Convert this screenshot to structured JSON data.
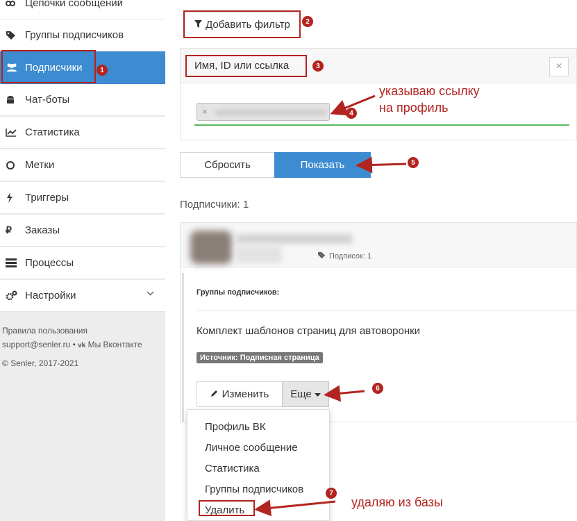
{
  "sidebar": {
    "items": [
      {
        "label": "Цепочки сообщений",
        "icon": "chain-icon"
      },
      {
        "label": "Группы подписчиков",
        "icon": "tag-icon"
      },
      {
        "label": "Подписчики",
        "icon": "users-icon"
      },
      {
        "label": "Чат-боты",
        "icon": "android-icon"
      },
      {
        "label": "Статистика",
        "icon": "chart-icon"
      },
      {
        "label": "Метки",
        "icon": "circle-icon"
      },
      {
        "label": "Триггеры",
        "icon": "bolt-icon"
      },
      {
        "label": "Заказы",
        "icon": "ruble-icon"
      },
      {
        "label": "Процессы",
        "icon": "list-icon"
      },
      {
        "label": "Настройки",
        "icon": "gears-icon"
      }
    ],
    "footer": {
      "terms": "Правила пользования",
      "support": "support@senler.ru",
      "vk": "Мы Вконтакте",
      "copyright": "© Senler, 2017-2021"
    }
  },
  "filter": {
    "add_filter_label": "Добавить фильтр",
    "field_label": "Имя, ID или ссылка",
    "close_label": "×",
    "tag_remove": "×"
  },
  "actions": {
    "reset_label": "Сбросить",
    "show_label": "Показать"
  },
  "results": {
    "count_text": "Подписчики: 1"
  },
  "subscriber": {
    "subscriptions_text": "Подписок: 1",
    "groups_heading": "Группы подписчиков:",
    "group_name": "Комплект шаблонов страниц для автоворонки",
    "source_badge": "Источник: Подписная страница",
    "edit_label": "Изменить",
    "more_label": "Еще"
  },
  "dropdown": {
    "items": [
      "Профиль ВК",
      "Личное сообщение",
      "Статистика",
      "Группы подписчиков",
      "Удалить"
    ]
  },
  "annotations": {
    "numbers": [
      "1",
      "2",
      "3",
      "4",
      "5",
      "6",
      "7"
    ],
    "note_link": "указываю ссылку\nна профиль",
    "note_delete": "удаляю из базы"
  },
  "colors": {
    "accent": "#3d8bd0",
    "annotation": "#b32420",
    "underline": "#5cb85c"
  }
}
